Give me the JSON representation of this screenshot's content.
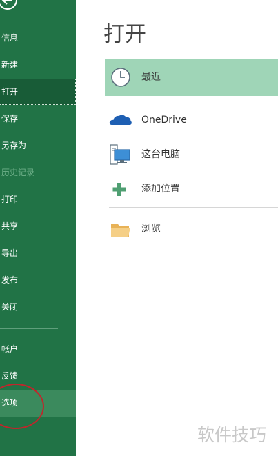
{
  "sidebar": {
    "items": [
      {
        "label": "信息"
      },
      {
        "label": "新建"
      },
      {
        "label": "打开"
      },
      {
        "label": "保存"
      },
      {
        "label": "另存为"
      },
      {
        "label": "历史记录"
      },
      {
        "label": "打印"
      },
      {
        "label": "共享"
      },
      {
        "label": "导出"
      },
      {
        "label": "发布"
      },
      {
        "label": "关闭"
      },
      {
        "label": "帐户"
      },
      {
        "label": "反馈"
      },
      {
        "label": "选项"
      }
    ]
  },
  "main": {
    "title": "打开",
    "locations": [
      {
        "label": "最近",
        "icon": "clock-icon",
        "selected": true
      },
      {
        "label": "OneDrive",
        "icon": "cloud-icon"
      },
      {
        "label": "这台电脑",
        "icon": "computer-icon"
      },
      {
        "label": "添加位置",
        "icon": "plus-icon"
      },
      {
        "label": "浏览",
        "icon": "folder-icon"
      }
    ]
  },
  "watermark": "软件技巧",
  "colors": {
    "sidebar_bg": "#217346",
    "sidebar_active": "#185c37",
    "selected_location": "#9fd5b7",
    "annotation_circle": "#c0262b"
  }
}
